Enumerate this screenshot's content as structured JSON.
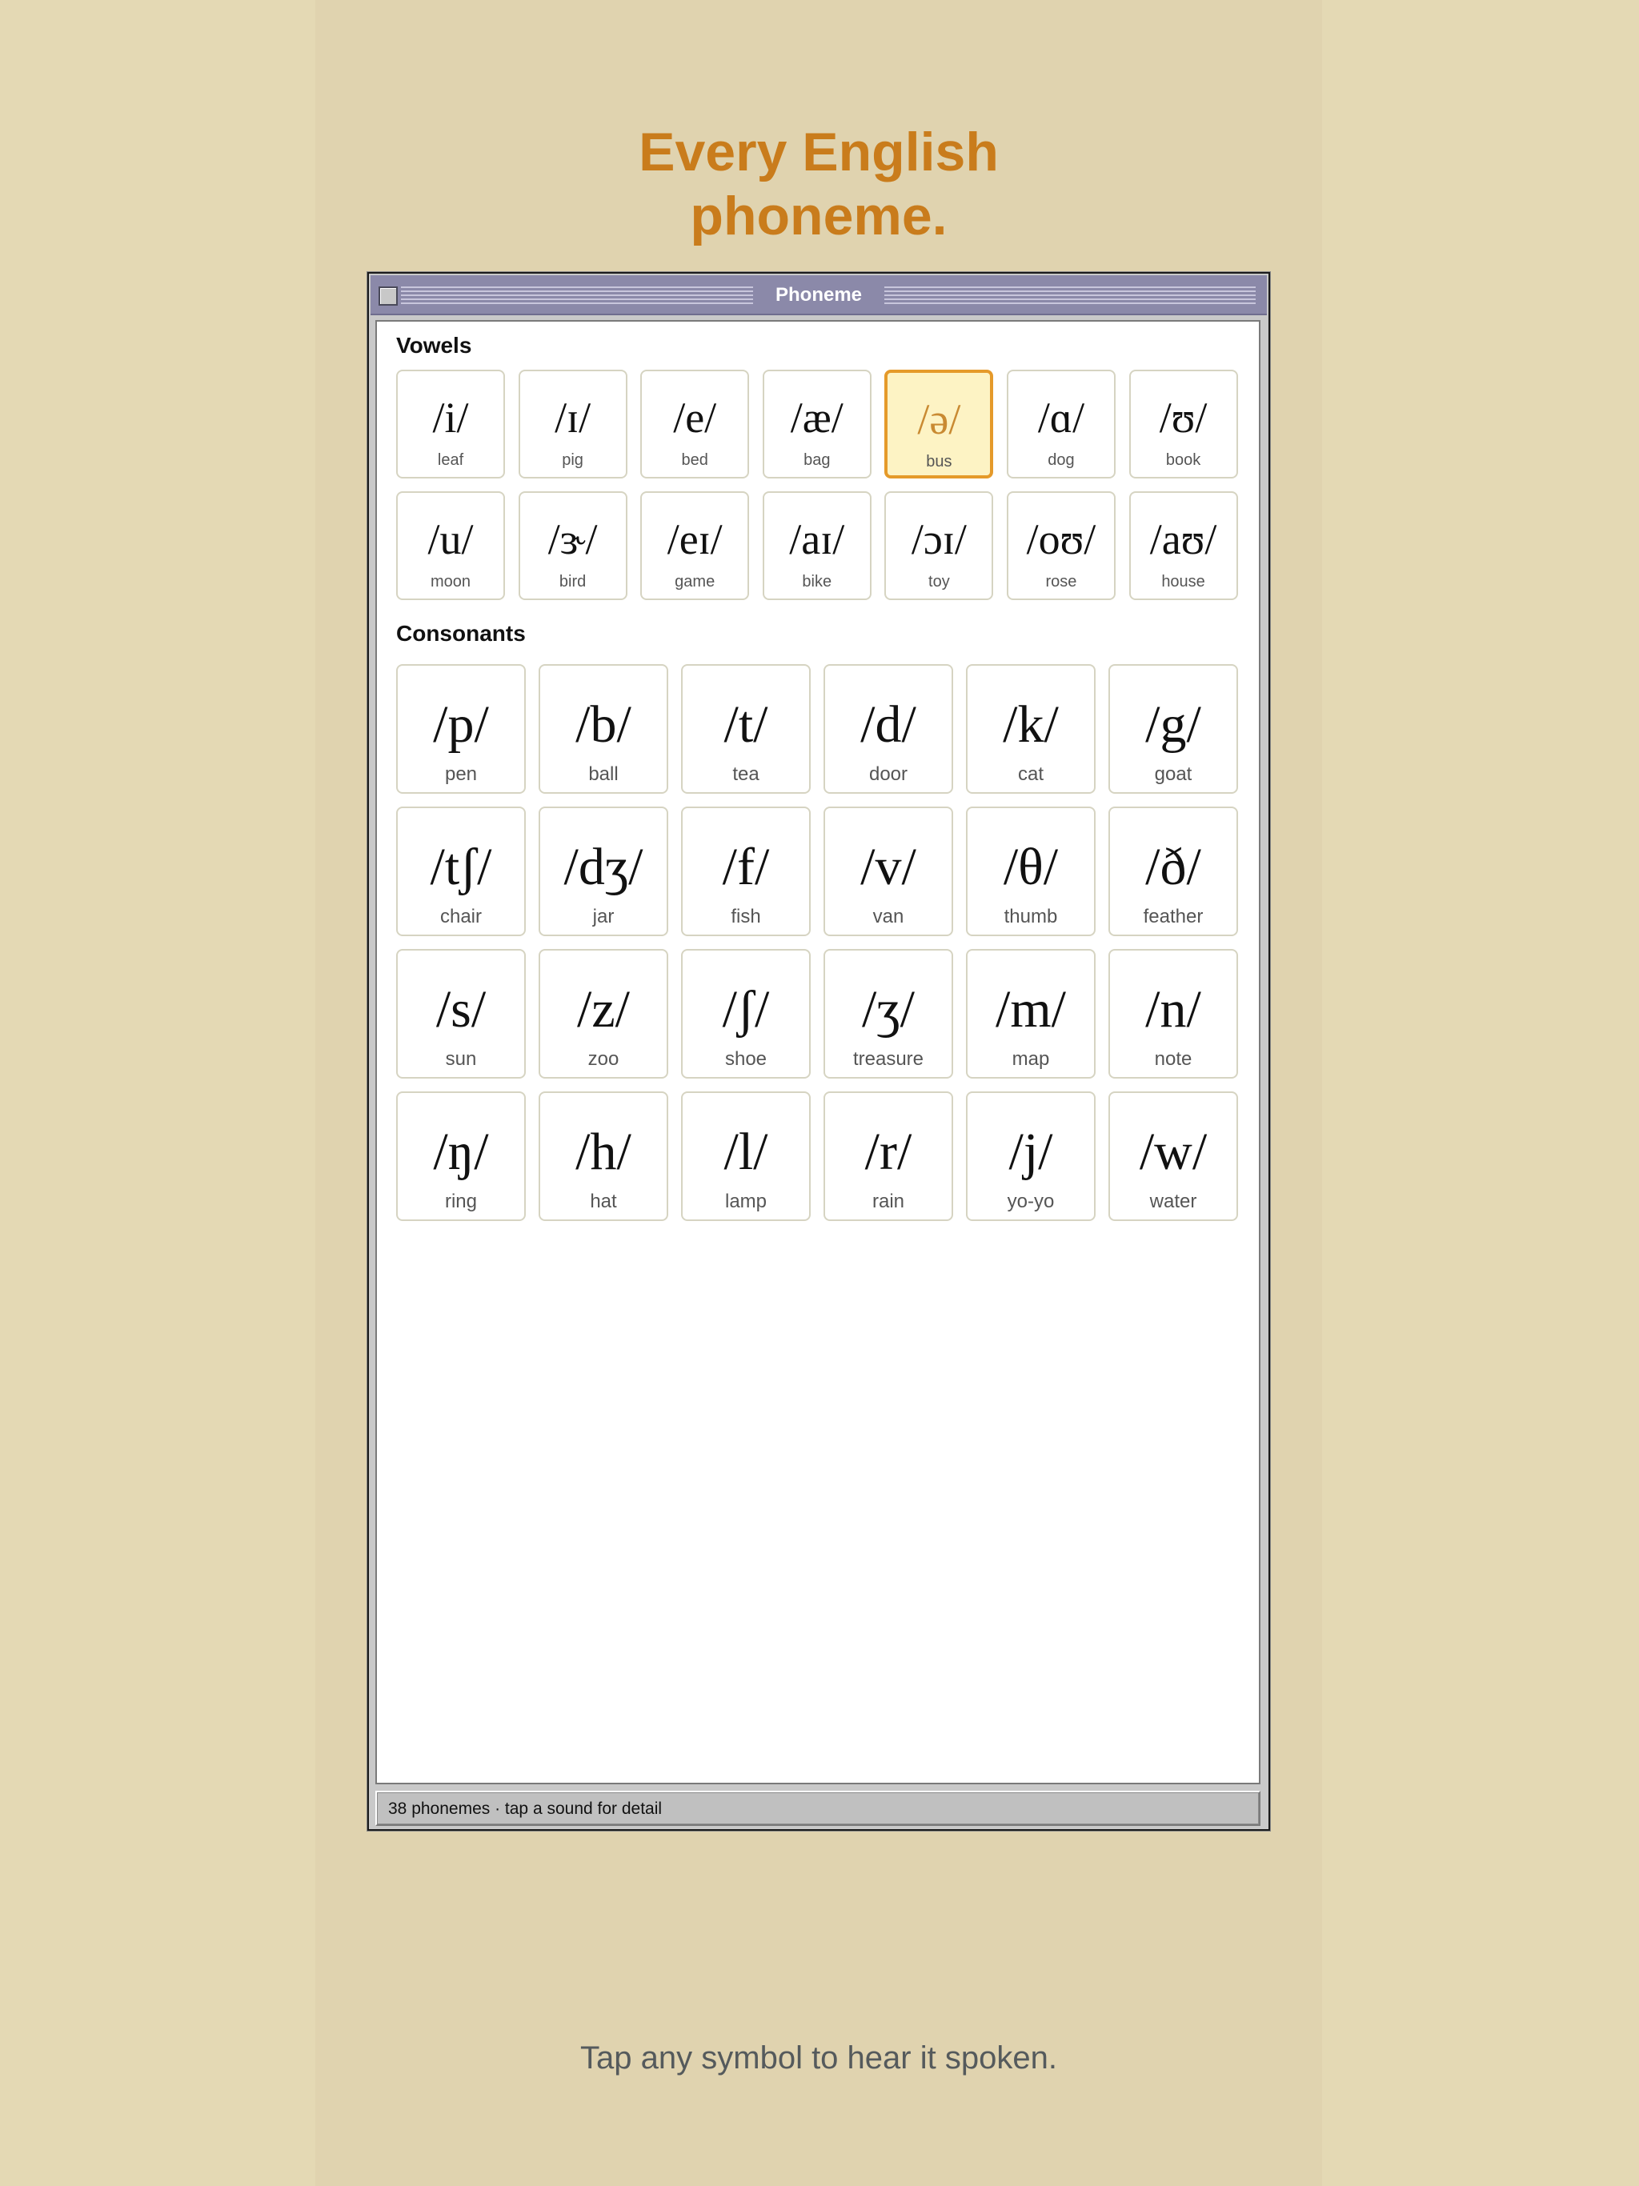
{
  "headline": {
    "line1": "Every English",
    "line2": "phoneme."
  },
  "window": {
    "title": "Phoneme",
    "status": "38 phonemes · tap a sound for detail"
  },
  "sections": {
    "vowels": "Vowels",
    "consonants": "Consonants"
  },
  "vowels": [
    {
      "symbol": "/i/",
      "word": "leaf"
    },
    {
      "symbol": "/ɪ/",
      "word": "pig"
    },
    {
      "symbol": "/e/",
      "word": "bed"
    },
    {
      "symbol": "/æ/",
      "word": "bag"
    },
    {
      "symbol": "/ə/",
      "word": "bus",
      "selected": true
    },
    {
      "symbol": "/ɑ/",
      "word": "dog"
    },
    {
      "symbol": "/ʊ/",
      "word": "book"
    },
    {
      "symbol": "/u/",
      "word": "moon"
    },
    {
      "symbol": "/ɝ/",
      "word": "bird"
    },
    {
      "symbol": "/eɪ/",
      "word": "game"
    },
    {
      "symbol": "/aɪ/",
      "word": "bike"
    },
    {
      "symbol": "/ɔɪ/",
      "word": "toy"
    },
    {
      "symbol": "/oʊ/",
      "word": "rose"
    },
    {
      "symbol": "/aʊ/",
      "word": "house"
    }
  ],
  "consonants": [
    {
      "symbol": "/p/",
      "word": "pen"
    },
    {
      "symbol": "/b/",
      "word": "ball"
    },
    {
      "symbol": "/t/",
      "word": "tea"
    },
    {
      "symbol": "/d/",
      "word": "door"
    },
    {
      "symbol": "/k/",
      "word": "cat"
    },
    {
      "symbol": "/g/",
      "word": "goat"
    },
    {
      "symbol": "/tʃ/",
      "word": "chair"
    },
    {
      "symbol": "/dʒ/",
      "word": "jar"
    },
    {
      "symbol": "/f/",
      "word": "fish"
    },
    {
      "symbol": "/v/",
      "word": "van"
    },
    {
      "symbol": "/θ/",
      "word": "thumb"
    },
    {
      "symbol": "/ð/",
      "word": "feather"
    },
    {
      "symbol": "/s/",
      "word": "sun"
    },
    {
      "symbol": "/z/",
      "word": "zoo"
    },
    {
      "symbol": "/ʃ/",
      "word": "shoe"
    },
    {
      "symbol": "/ʒ/",
      "word": "treasure"
    },
    {
      "symbol": "/m/",
      "word": "map"
    },
    {
      "symbol": "/n/",
      "word": "note"
    },
    {
      "symbol": "/ŋ/",
      "word": "ring"
    },
    {
      "symbol": "/h/",
      "word": "hat"
    },
    {
      "symbol": "/l/",
      "word": "lamp"
    },
    {
      "symbol": "/r/",
      "word": "rain"
    },
    {
      "symbol": "/j/",
      "word": "yo-yo"
    },
    {
      "symbol": "/w/",
      "word": "water"
    }
  ],
  "footer": "Tap any symbol to hear it spoken.",
  "colors": {
    "accent": "#c97c1c",
    "selected_border": "#e59a2a",
    "selected_fill": "#fdf3c4",
    "titlebar": "#8b89a9",
    "background": "#e4d9b4"
  }
}
